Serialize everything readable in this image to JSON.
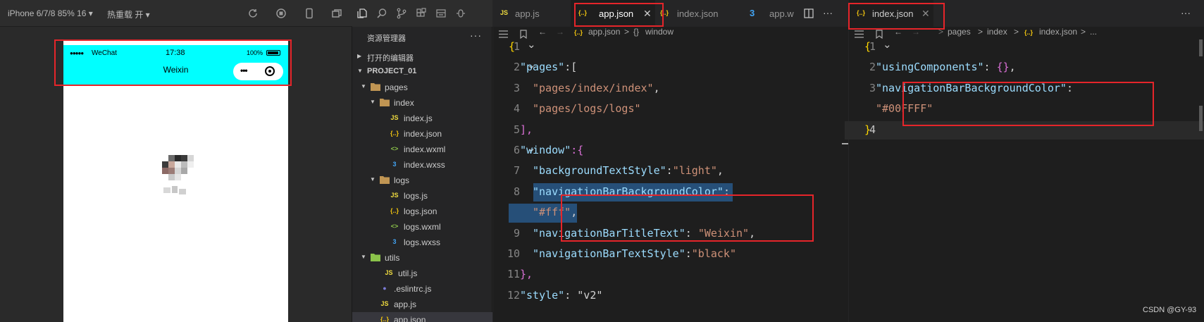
{
  "simulator": {
    "device_label": "iPhone 6/7/8 85% 16 ▾",
    "hot_reload_label": "热重载 开 ▾",
    "status": {
      "dots": "●●●●●",
      "carrier": "WeChat",
      "time": "17:38",
      "battery_pct": "100%"
    },
    "nav_title": "Weixin",
    "nav_color": "#00FFFF"
  },
  "explorer": {
    "title": "资源管理器",
    "more": "···",
    "open_editors": "打开的编辑器",
    "project": "PROJECT_01",
    "tree": [
      {
        "label": "pages",
        "type": "folder",
        "icon": "folder-icon"
      },
      {
        "label": "index",
        "type": "folder",
        "icon": "folder-icon"
      },
      {
        "label": "index.js",
        "type": "js",
        "icon": "JS"
      },
      {
        "label": "index.json",
        "type": "json",
        "icon": "{..}"
      },
      {
        "label": "index.wxml",
        "type": "wxml",
        "icon": "<>"
      },
      {
        "label": "index.wxss",
        "type": "wxss",
        "icon": "3"
      },
      {
        "label": "logs",
        "type": "folder",
        "icon": "folder-icon"
      },
      {
        "label": "logs.js",
        "type": "js",
        "icon": "JS"
      },
      {
        "label": "logs.json",
        "type": "json",
        "icon": "{..}"
      },
      {
        "label": "logs.wxml",
        "type": "wxml",
        "icon": "<>"
      },
      {
        "label": "logs.wxss",
        "type": "wxss",
        "icon": "3"
      },
      {
        "label": "utils",
        "type": "folder",
        "icon": "folder-icon"
      },
      {
        "label": "util.js",
        "type": "js",
        "icon": "JS"
      },
      {
        "label": ".eslintrc.js",
        "type": "eslint",
        "icon": "●"
      },
      {
        "label": "app.js",
        "type": "js",
        "icon": "JS"
      },
      {
        "label": "app.json",
        "type": "json",
        "icon": "{..}"
      }
    ]
  },
  "editor1": {
    "tabs": [
      {
        "label": "app.js",
        "icon": "JS"
      },
      {
        "label": "app.json",
        "icon": "{..}",
        "close": "✕"
      },
      {
        "label": "index.json",
        "icon": "{..}"
      },
      {
        "label": "app.w",
        "icon": "3"
      }
    ],
    "more": "···",
    "breadcrumb": {
      "file": "app.json",
      "sep": ">",
      "node": "window",
      "node_icon": "{}"
    },
    "line_numbers": [
      "1",
      "2",
      "3",
      "4",
      "5",
      "6",
      "7",
      "8",
      "",
      "9",
      "10",
      "11",
      "12"
    ],
    "code": {
      "l1": "{",
      "l2_key": "\"pages\"",
      "l2_rest": ":[",
      "l3": "\"pages/index/index\"",
      "l3_comma": ",",
      "l4": "\"pages/logs/logs\"",
      "l5": "],",
      "l6_key": "\"window\"",
      "l6_rest": ":{",
      "l7_key": "\"backgroundTextStyle\"",
      "l7_colon": ":",
      "l7_val": "\"light\"",
      "l7_comma": ",",
      "l8_key": "\"navigationBarBackgroundColor\"",
      "l8_colon": ":",
      "l8b_val": "\"#fff\"",
      "l8b_comma": ",",
      "l9_key": "\"navigationBarTitleText\"",
      "l9_colon": ": ",
      "l9_val": "\"Weixin\"",
      "l9_comma": ",",
      "l10_key": "\"navigationBarTextStyle\"",
      "l10_colon": ":",
      "l10_val": "\"black\"",
      "l11": "},",
      "l12_key": "\"style\"",
      "l12_rest": ": \"v2\""
    }
  },
  "editor2": {
    "tab": {
      "label": "index.json",
      "icon": "{..}",
      "close": "✕"
    },
    "more": "···",
    "breadcrumb": {
      "a": "pages",
      "b": "index",
      "file": "index.json",
      "tail": "...",
      "sep": ">"
    },
    "line_numbers": [
      "1",
      "2",
      "3",
      "",
      "4"
    ],
    "code": {
      "l1": "{",
      "l2_key": "\"usingComponents\"",
      "l2_colon": ": ",
      "l2_val": "{}",
      "l2_comma": ",",
      "l3_key": "\"navigationBarBackgroundColor\"",
      "l3_colon": ":",
      "l3b_val": "\"#00FFFF\"",
      "l4": "}"
    }
  },
  "watermark": "CSDN @GY-93"
}
